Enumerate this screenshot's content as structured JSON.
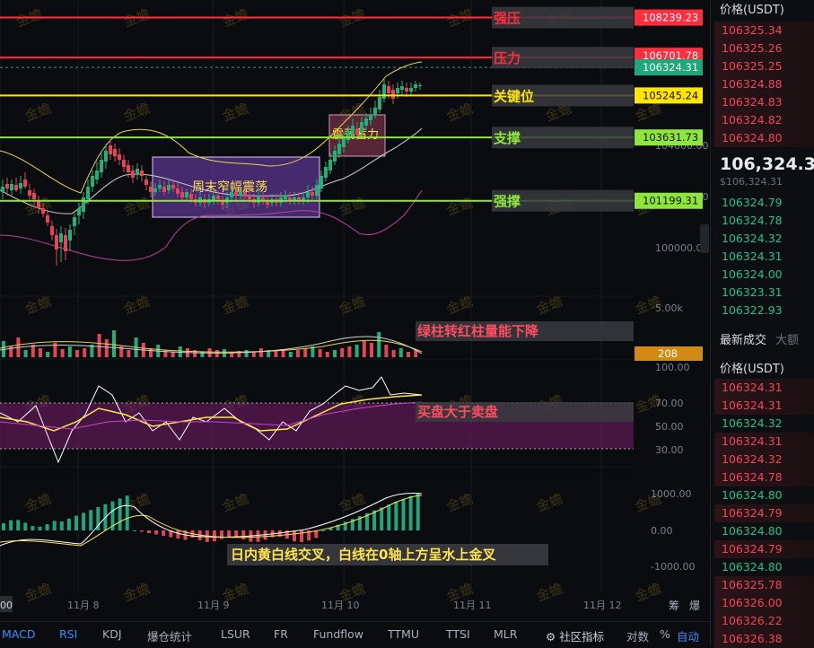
{
  "chart_data": {
    "type": "candlestick-with-indicators",
    "x_ticks": [
      "00",
      "11月 8",
      "11月 9",
      "11月 10",
      "11月 11",
      "11月 12"
    ],
    "price_axis": {
      "labels": [
        "104000.00",
        "102000.00",
        "100000.00"
      ]
    },
    "levels": [
      {
        "name": "强压",
        "value": "108239.23",
        "color": "#ff2d3d"
      },
      {
        "name": "压力",
        "value": "106701.78",
        "color": "#ff2d3d"
      },
      {
        "name": "",
        "value": "106324.31",
        "color": "#1fa67a"
      },
      {
        "name": "关键位",
        "value": "105245.24",
        "color": "#ffe600"
      },
      {
        "name": "支撑",
        "value": "103631.73",
        "color": "#8fe63a"
      },
      {
        "name": "强撑",
        "value": "101199.31",
        "color": "#8fe63a"
      }
    ],
    "boxes": [
      {
        "label": "周末窄幅震荡"
      },
      {
        "label": "震荡蓄力"
      }
    ],
    "volume": {
      "axis_label": "5.00k",
      "current": "208",
      "annotation": "绿柱转红柱量能下降"
    },
    "rsi": {
      "axis_labels": [
        "100.00",
        "70.00",
        "50.00",
        "30.00"
      ],
      "annotation": "买盘大于卖盘"
    },
    "macd": {
      "axis_labels": [
        "1000.00",
        "0.00",
        "-1000.00"
      ],
      "annotation": "日内黄白线交叉，白线在0轴上方呈水上金叉"
    },
    "watermark": "金蟾"
  },
  "toolbar": {
    "items": [
      "MACD",
      "RSI",
      "KDJ",
      "爆仓统计",
      "LSUR",
      "FR",
      "Fundflow",
      "TTMU",
      "TTSI",
      "MLR"
    ],
    "community": "社区指标",
    "log": "对数",
    "pct": "%",
    "auto": "自动",
    "right_top": [
      "筹",
      "爆"
    ]
  },
  "orderbook": {
    "header": "价格(USDT)",
    "asks": [
      "106325.34",
      "106325.26",
      "106325.25",
      "106324.88",
      "106324.83",
      "106324.82",
      "106324.80"
    ],
    "last": "106,324.31",
    "last_usd": "$106,324.31",
    "bids": [
      "106324.79",
      "106324.78",
      "106324.32",
      "106324.31",
      "106324.00",
      "106323.31",
      "106322.93"
    ],
    "trades_tab": "最新成交",
    "trades_tab2": "大额",
    "trades_header": "价格(USDT)",
    "trades": [
      {
        "p": "106324.31",
        "c": "red"
      },
      {
        "p": "106324.31",
        "c": "red"
      },
      {
        "p": "106324.32",
        "c": "green"
      },
      {
        "p": "106324.31",
        "c": "red"
      },
      {
        "p": "106324.32",
        "c": "red"
      },
      {
        "p": "106324.78",
        "c": "red"
      },
      {
        "p": "106324.80",
        "c": "green"
      },
      {
        "p": "106324.79",
        "c": "red"
      },
      {
        "p": "106324.80",
        "c": "green"
      },
      {
        "p": "106324.79",
        "c": "red"
      },
      {
        "p": "106324.80",
        "c": "green"
      },
      {
        "p": "106325.78",
        "c": "red"
      },
      {
        "p": "106326.00",
        "c": "red"
      },
      {
        "p": "106326.22",
        "c": "red"
      },
      {
        "p": "106326.38",
        "c": "red"
      }
    ]
  }
}
